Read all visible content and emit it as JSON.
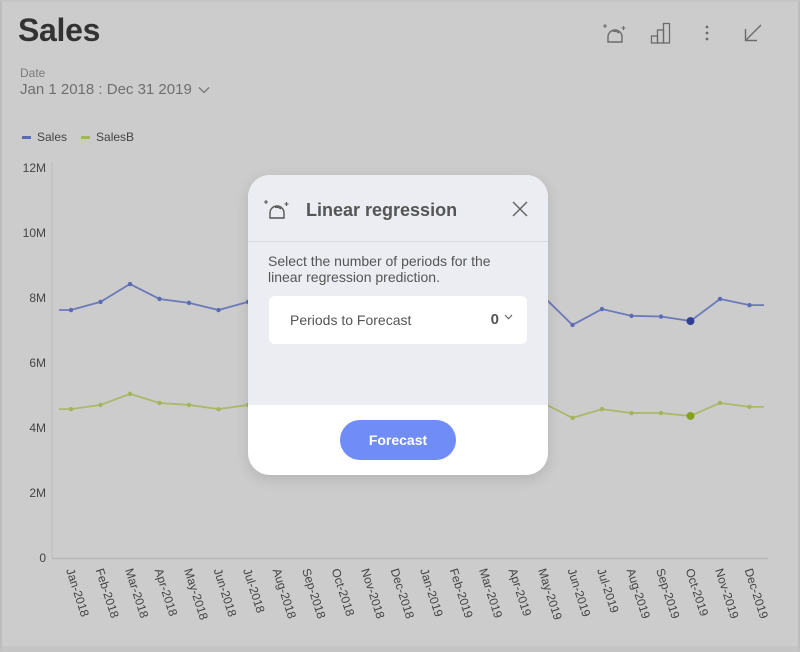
{
  "header": {
    "title": "Sales",
    "date_label": "Date",
    "date_range": "Jan 1 2018 : Dec 31 2019"
  },
  "toolbar": {
    "icons": [
      "forecast-icon",
      "chart-type-icon",
      "more-options-icon",
      "collapse-icon"
    ]
  },
  "colors": {
    "sales": "#5c6bb5",
    "sales_highlight": "#2f3f96",
    "salesB": "#a3b55a",
    "salesB_highlight": "#84a21d",
    "accent": "#6f8cf7"
  },
  "chart_data": {
    "type": "line",
    "title": "Sales",
    "xlabel": "",
    "ylabel": "",
    "ylim": [
      0,
      12000000
    ],
    "yticks": [
      0,
      2000000,
      4000000,
      6000000,
      8000000,
      10000000,
      12000000
    ],
    "ytick_labels": [
      "0",
      "2M",
      "4M",
      "6M",
      "8M",
      "10M",
      "12M"
    ],
    "grid": false,
    "legend_position": "top-left",
    "categories": [
      "Jan-2018",
      "Feb-2018",
      "Mar-2018",
      "Apr-2018",
      "May-2018",
      "Jun-2018",
      "Jul-2018",
      "Aug-2018",
      "Sep-2018",
      "Oct-2018",
      "Nov-2018",
      "Dec-2018",
      "Jan-2019",
      "Feb-2019",
      "Mar-2019",
      "Apr-2019",
      "May-2019",
      "Jun-2019",
      "Jul-2019",
      "Aug-2019",
      "Sep-2019",
      "Oct-2019",
      "Nov-2019",
      "Dec-2019"
    ],
    "highlight_index": 21,
    "series": [
      {
        "name": "Sales",
        "values": [
          7630000,
          7880000,
          8430000,
          7970000,
          7850000,
          7630000,
          7880000,
          7900000,
          7800000,
          7950000,
          7850000,
          7900000,
          7800000,
          7950000,
          8000000,
          8100000,
          8060000,
          7170000,
          7660000,
          7450000,
          7430000,
          7290000,
          7970000,
          7780000
        ]
      },
      {
        "name": "SalesB",
        "values": [
          4580000,
          4710000,
          5050000,
          4770000,
          4710000,
          4580000,
          4710000,
          4720000,
          4660000,
          4750000,
          4690000,
          4720000,
          4660000,
          4750000,
          4780000,
          4840000,
          4770000,
          4310000,
          4580000,
          4460000,
          4460000,
          4370000,
          4770000,
          4650000
        ]
      }
    ]
  },
  "modal": {
    "title": "Linear regression",
    "description": "Select the number of periods for the linear regression prediction.",
    "periods_label": "Periods to Forecast",
    "periods_value": "0",
    "forecast_button": "Forecast"
  }
}
